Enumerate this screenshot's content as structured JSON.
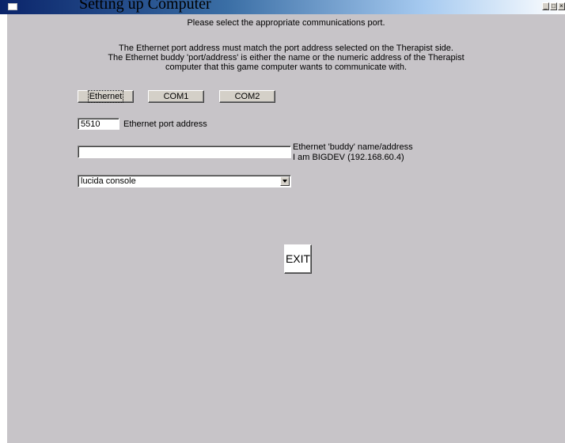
{
  "window": {
    "title": "Setting up Computer"
  },
  "header": {
    "instruction": "Please select the appropriate communications port."
  },
  "info": {
    "line1": "The Ethernet port address must match the port address selected on the Therapist side.",
    "line2": "The Ethernet buddy 'port/address' is either the name or the numeric address of the Therapist",
    "line3": "computer that this game computer wants to communicate with."
  },
  "ports": {
    "ethernet_label": "Ethernet",
    "com1_label": "COM1",
    "com2_label": "COM2",
    "selected": "Ethernet"
  },
  "port_address": {
    "value": "5510",
    "label": "Ethernet port address"
  },
  "buddy": {
    "value": "",
    "label": "Ethernet 'buddy' name/address",
    "self_info": "I am BIGDEV (192.168.60.4)"
  },
  "font_select": {
    "value": "lucida console"
  },
  "exit_label": "EXIT"
}
